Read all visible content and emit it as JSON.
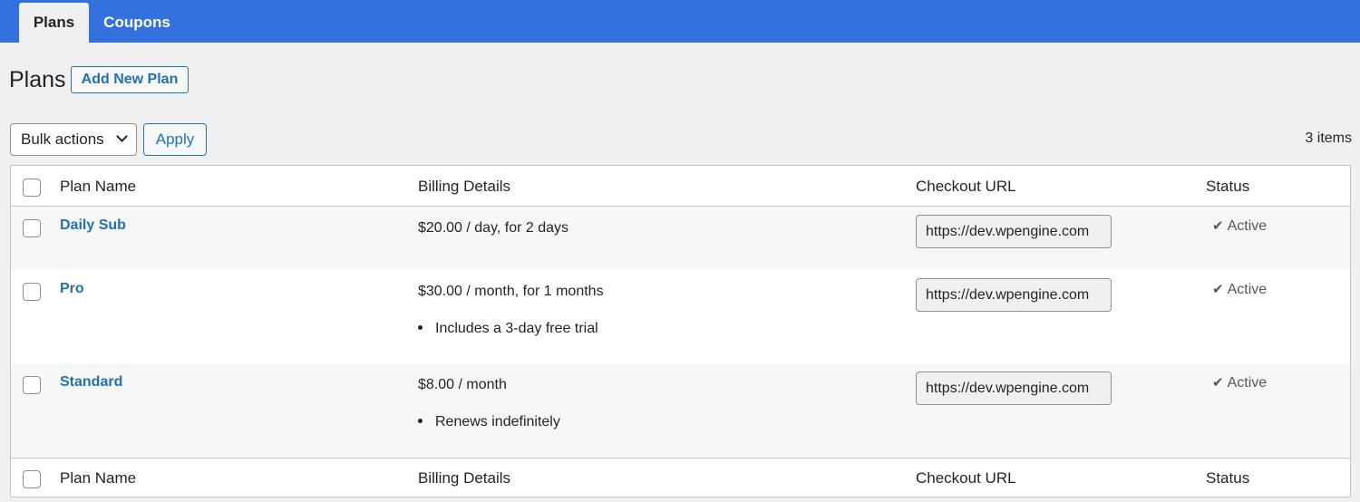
{
  "tabs": [
    {
      "label": "Plans",
      "active": true
    },
    {
      "label": "Coupons",
      "active": false
    }
  ],
  "page": {
    "title": "Plans",
    "add_new_label": "Add New Plan"
  },
  "toolbar": {
    "bulk_actions_label": "Bulk actions",
    "apply_label": "Apply",
    "item_count": "3 items"
  },
  "table": {
    "columns": [
      "Plan Name",
      "Billing Details",
      "Checkout URL",
      "Status"
    ],
    "rows": [
      {
        "name": "Daily Sub",
        "billing": "$20.00 / day, for 2 days",
        "billing_note": "",
        "checkout_url": "https://dev.wpengine.com",
        "status": "Active"
      },
      {
        "name": "Pro",
        "billing": "$30.00 / month, for 1 months",
        "billing_note": "Includes a 3-day free trial",
        "checkout_url": "https://dev.wpengine.com",
        "status": "Active"
      },
      {
        "name": "Standard",
        "billing": "$8.00 / month",
        "billing_note": "Renews indefinitely",
        "checkout_url": "https://dev.wpengine.com",
        "status": "Active"
      }
    ]
  },
  "colors": {
    "tabbar": "#3371de",
    "link": "#2271b1",
    "background": "#f0f0f1"
  },
  "icons": {
    "dropdown": "chevron-down-icon",
    "status": "checkmark-icon"
  }
}
